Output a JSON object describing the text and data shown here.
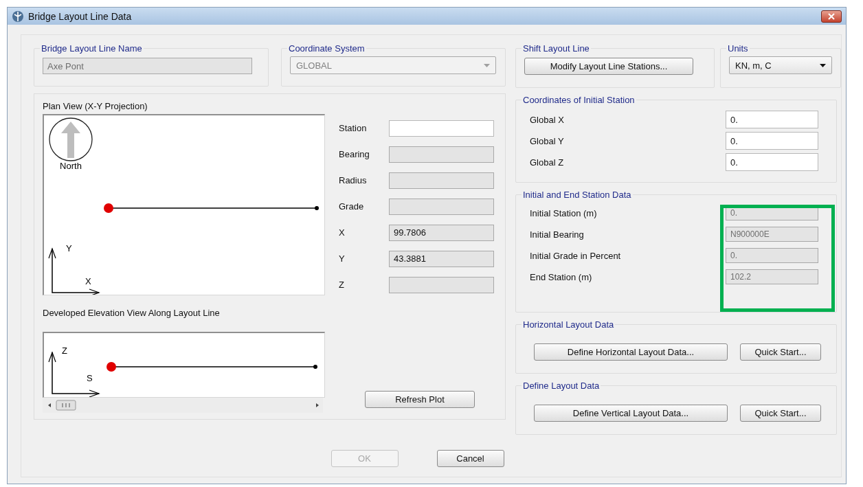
{
  "window": {
    "title": "Bridge Layout Line Data"
  },
  "layout_line_name": {
    "label": "Bridge Layout Line Name",
    "value": "Axe Pont",
    "disabled": true
  },
  "coordinate_system": {
    "label": "Coordinate System",
    "value": "GLOBAL",
    "disabled": true
  },
  "shift_layout_line": {
    "label": "Shift Layout Line",
    "button": "Modify Layout Line Stations..."
  },
  "units": {
    "label": "Units",
    "value": "KN, m, C",
    "disabled": false
  },
  "plan_view": {
    "title": "Plan View (X-Y Projection)",
    "north_label": "North",
    "axis_labels": [
      "Y",
      "X"
    ]
  },
  "point_info": [
    {
      "label": "Station",
      "disabled": false
    },
    {
      "label": "Bearing",
      "disabled": true
    },
    {
      "label": "Radius",
      "disabled": true
    },
    {
      "label": "Grade",
      "disabled": true
    },
    {
      "label": "X",
      "value": "99.7806",
      "disabled": true
    },
    {
      "label": "Y",
      "value": "43.3881",
      "disabled": true
    },
    {
      "label": "Z",
      "disabled": true
    }
  ],
  "elevation_view": {
    "title": "Developed Elevation View Along Layout Line",
    "axis_labels": [
      "Z",
      "S"
    ]
  },
  "refresh_button": "Refresh Plot",
  "initial_station_coordinates": {
    "title": "Coordinates of Initial Station",
    "rows": [
      {
        "label": "Global X",
        "value": "0.",
        "disabled": false
      },
      {
        "label": "Global Y",
        "value": "0.",
        "disabled": false
      },
      {
        "label": "Global Z",
        "value": "0.",
        "disabled": false
      }
    ]
  },
  "station_data": {
    "title": "Initial and End Station Data",
    "rows": [
      {
        "label": "Initial Station  (m)",
        "value": "0.",
        "disabled": true
      },
      {
        "label": "Initial Bearing",
        "value": "N900000E",
        "disabled": true
      },
      {
        "label": "Initial Grade in Percent",
        "value": "0.",
        "disabled": true
      },
      {
        "label": "End Station  (m)",
        "value": "102.2",
        "disabled": true
      }
    ]
  },
  "horizontal_layout": {
    "title": "Horizontal Layout Data",
    "buttons": [
      "Define Horizontal Layout Data...",
      "Quick Start..."
    ]
  },
  "vertical_layout": {
    "title": "Define Layout Data",
    "buttons": [
      "Define Vertical Layout Data...",
      "Quick Start..."
    ]
  },
  "buttons": [
    {
      "label": "OK",
      "disabled": true
    },
    {
      "label": "Cancel",
      "disabled": false
    }
  ],
  "highlight": {
    "kind": "rectangle"
  }
}
